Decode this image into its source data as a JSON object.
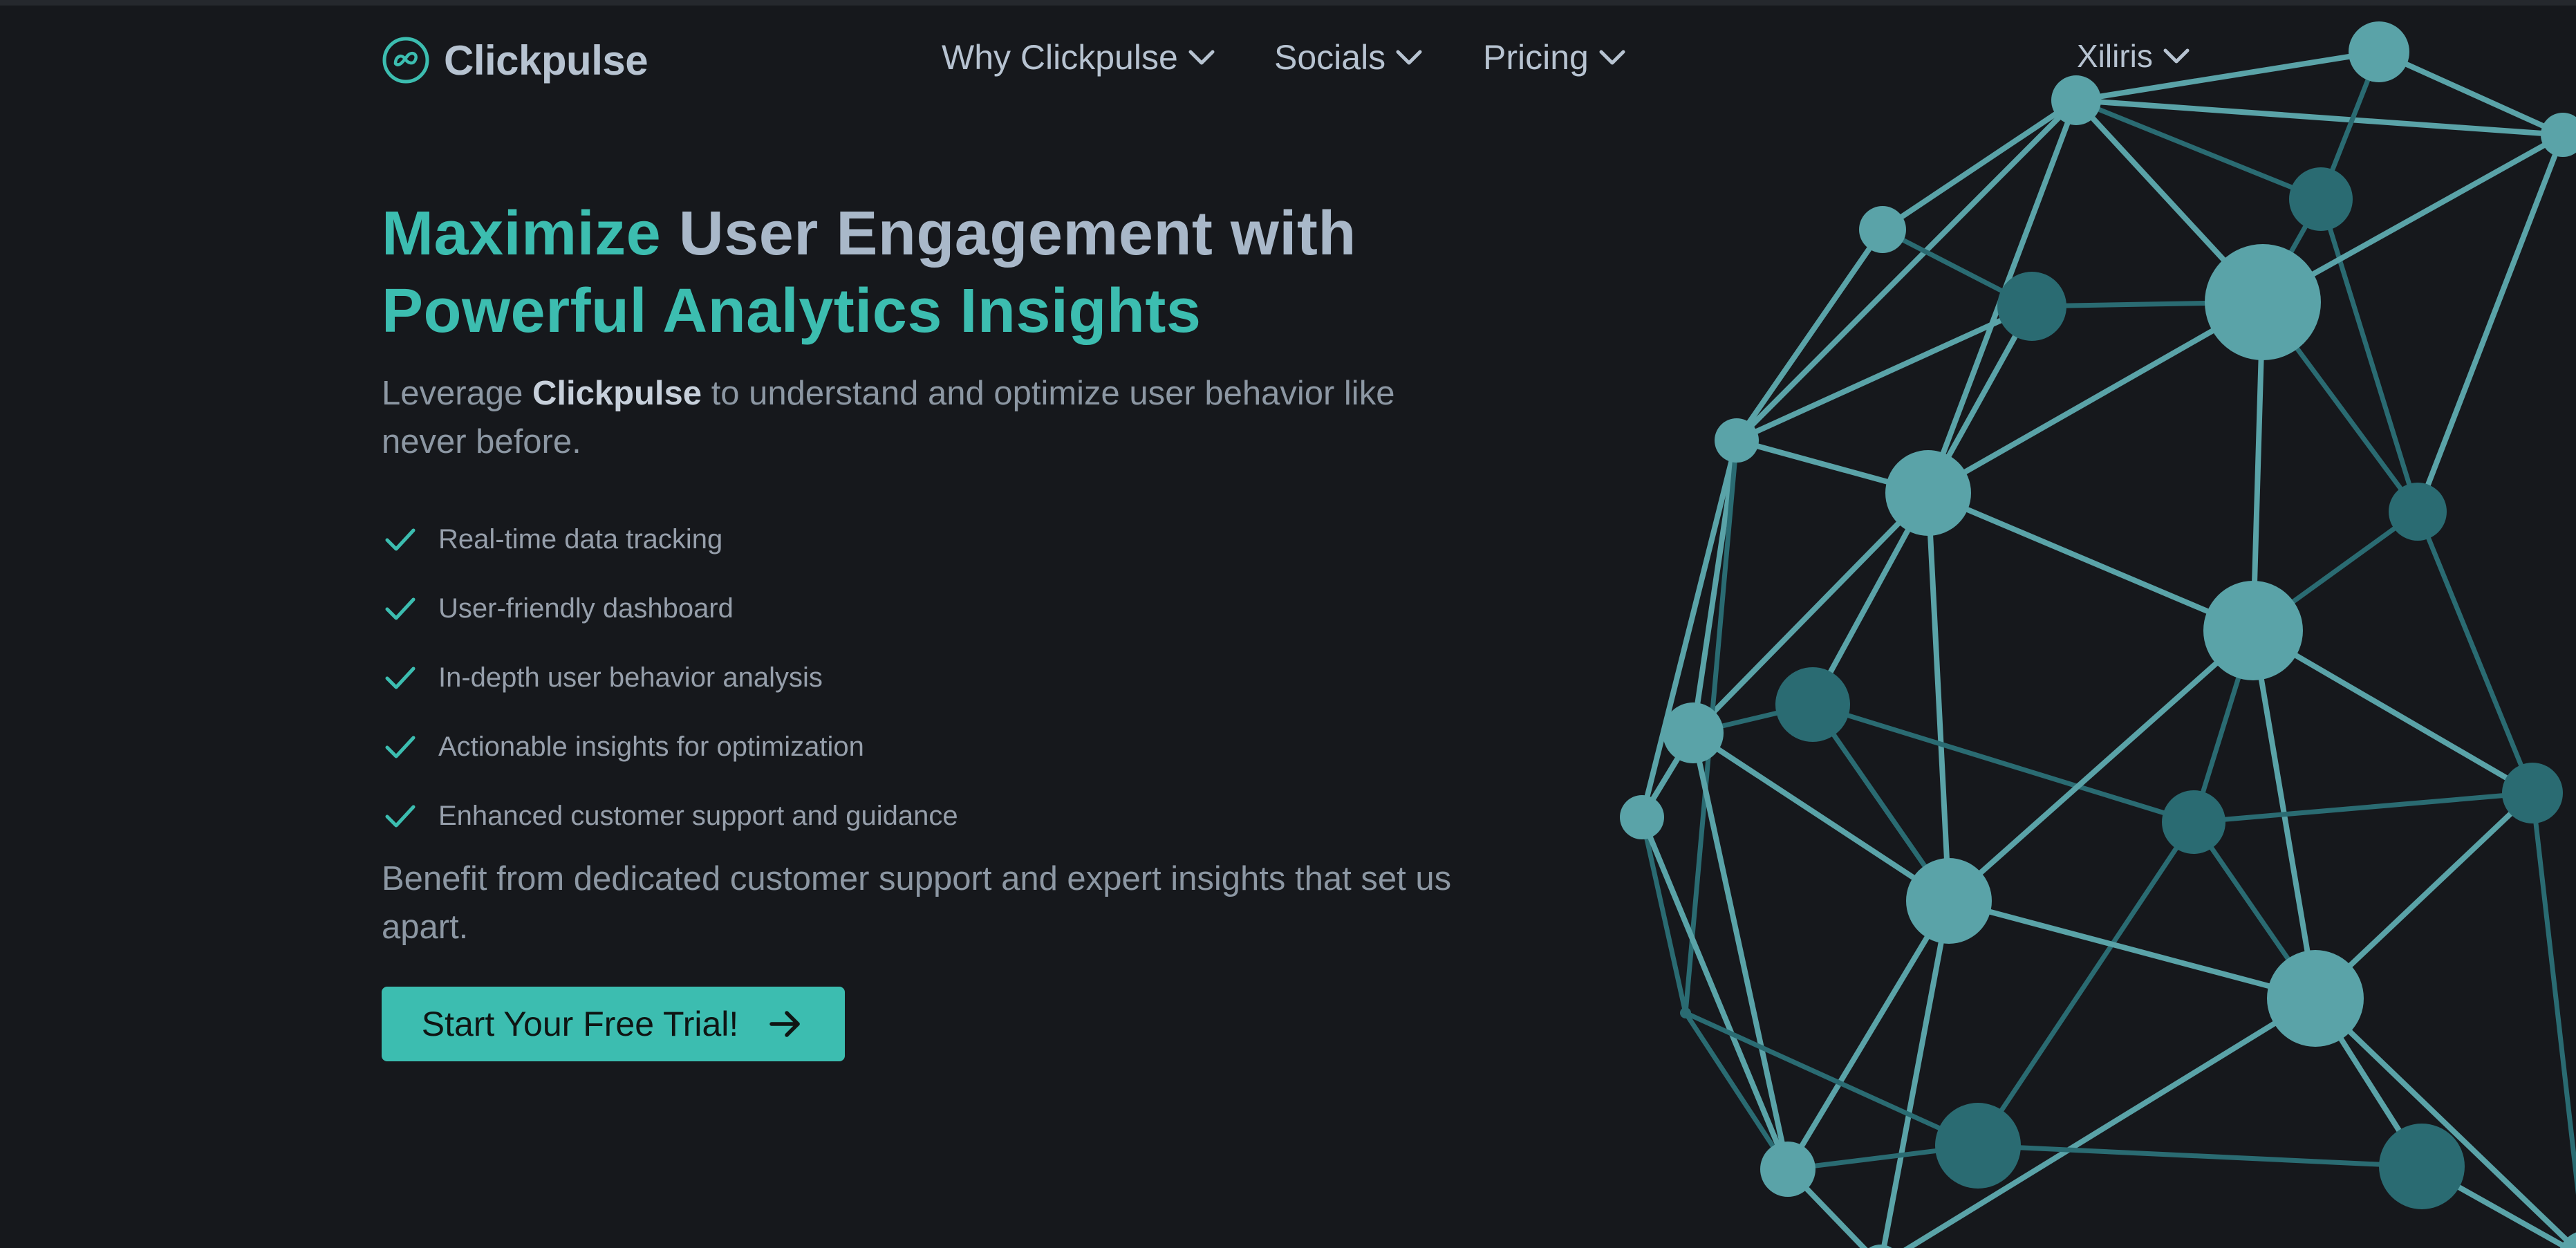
{
  "brand": {
    "name": "Clickpulse"
  },
  "nav": {
    "items": [
      {
        "label": "Why Clickpulse"
      },
      {
        "label": "Socials"
      },
      {
        "label": "Pricing"
      }
    ],
    "language": "Xiliris"
  },
  "hero": {
    "headline_accent_1": "Maximize",
    "headline_mid": "User Engagement with",
    "headline_accent_2": "Powerful Analytics Insights",
    "subtitle_pre": "Leverage",
    "subtitle_brand": "Clickpulse",
    "subtitle_post": "to understand and optimize user behavior like never before.",
    "features": [
      "Real-time data tracking",
      "User-friendly dashboard",
      "In-depth user behavior analysis",
      "Actionable insights for optimization",
      "Enhanced customer support and guidance"
    ],
    "benefit": "Benefit from dedicated customer support and expert insights that set us apart.",
    "cta_label": "Start Your Free Trial!"
  },
  "colors": {
    "background": "#16181c",
    "accent": "#3cbdb0",
    "text_muted": "#a9b8c9",
    "network_light": "#5aa3a8",
    "network_dark": "#2a6b72"
  },
  "icons": {
    "logo": "infinity-circle-logo-icon",
    "nav_chevron": "chevron-down-icon",
    "feature_check": "checkmark-icon",
    "cta_arrow": "arrow-right-icon"
  }
}
